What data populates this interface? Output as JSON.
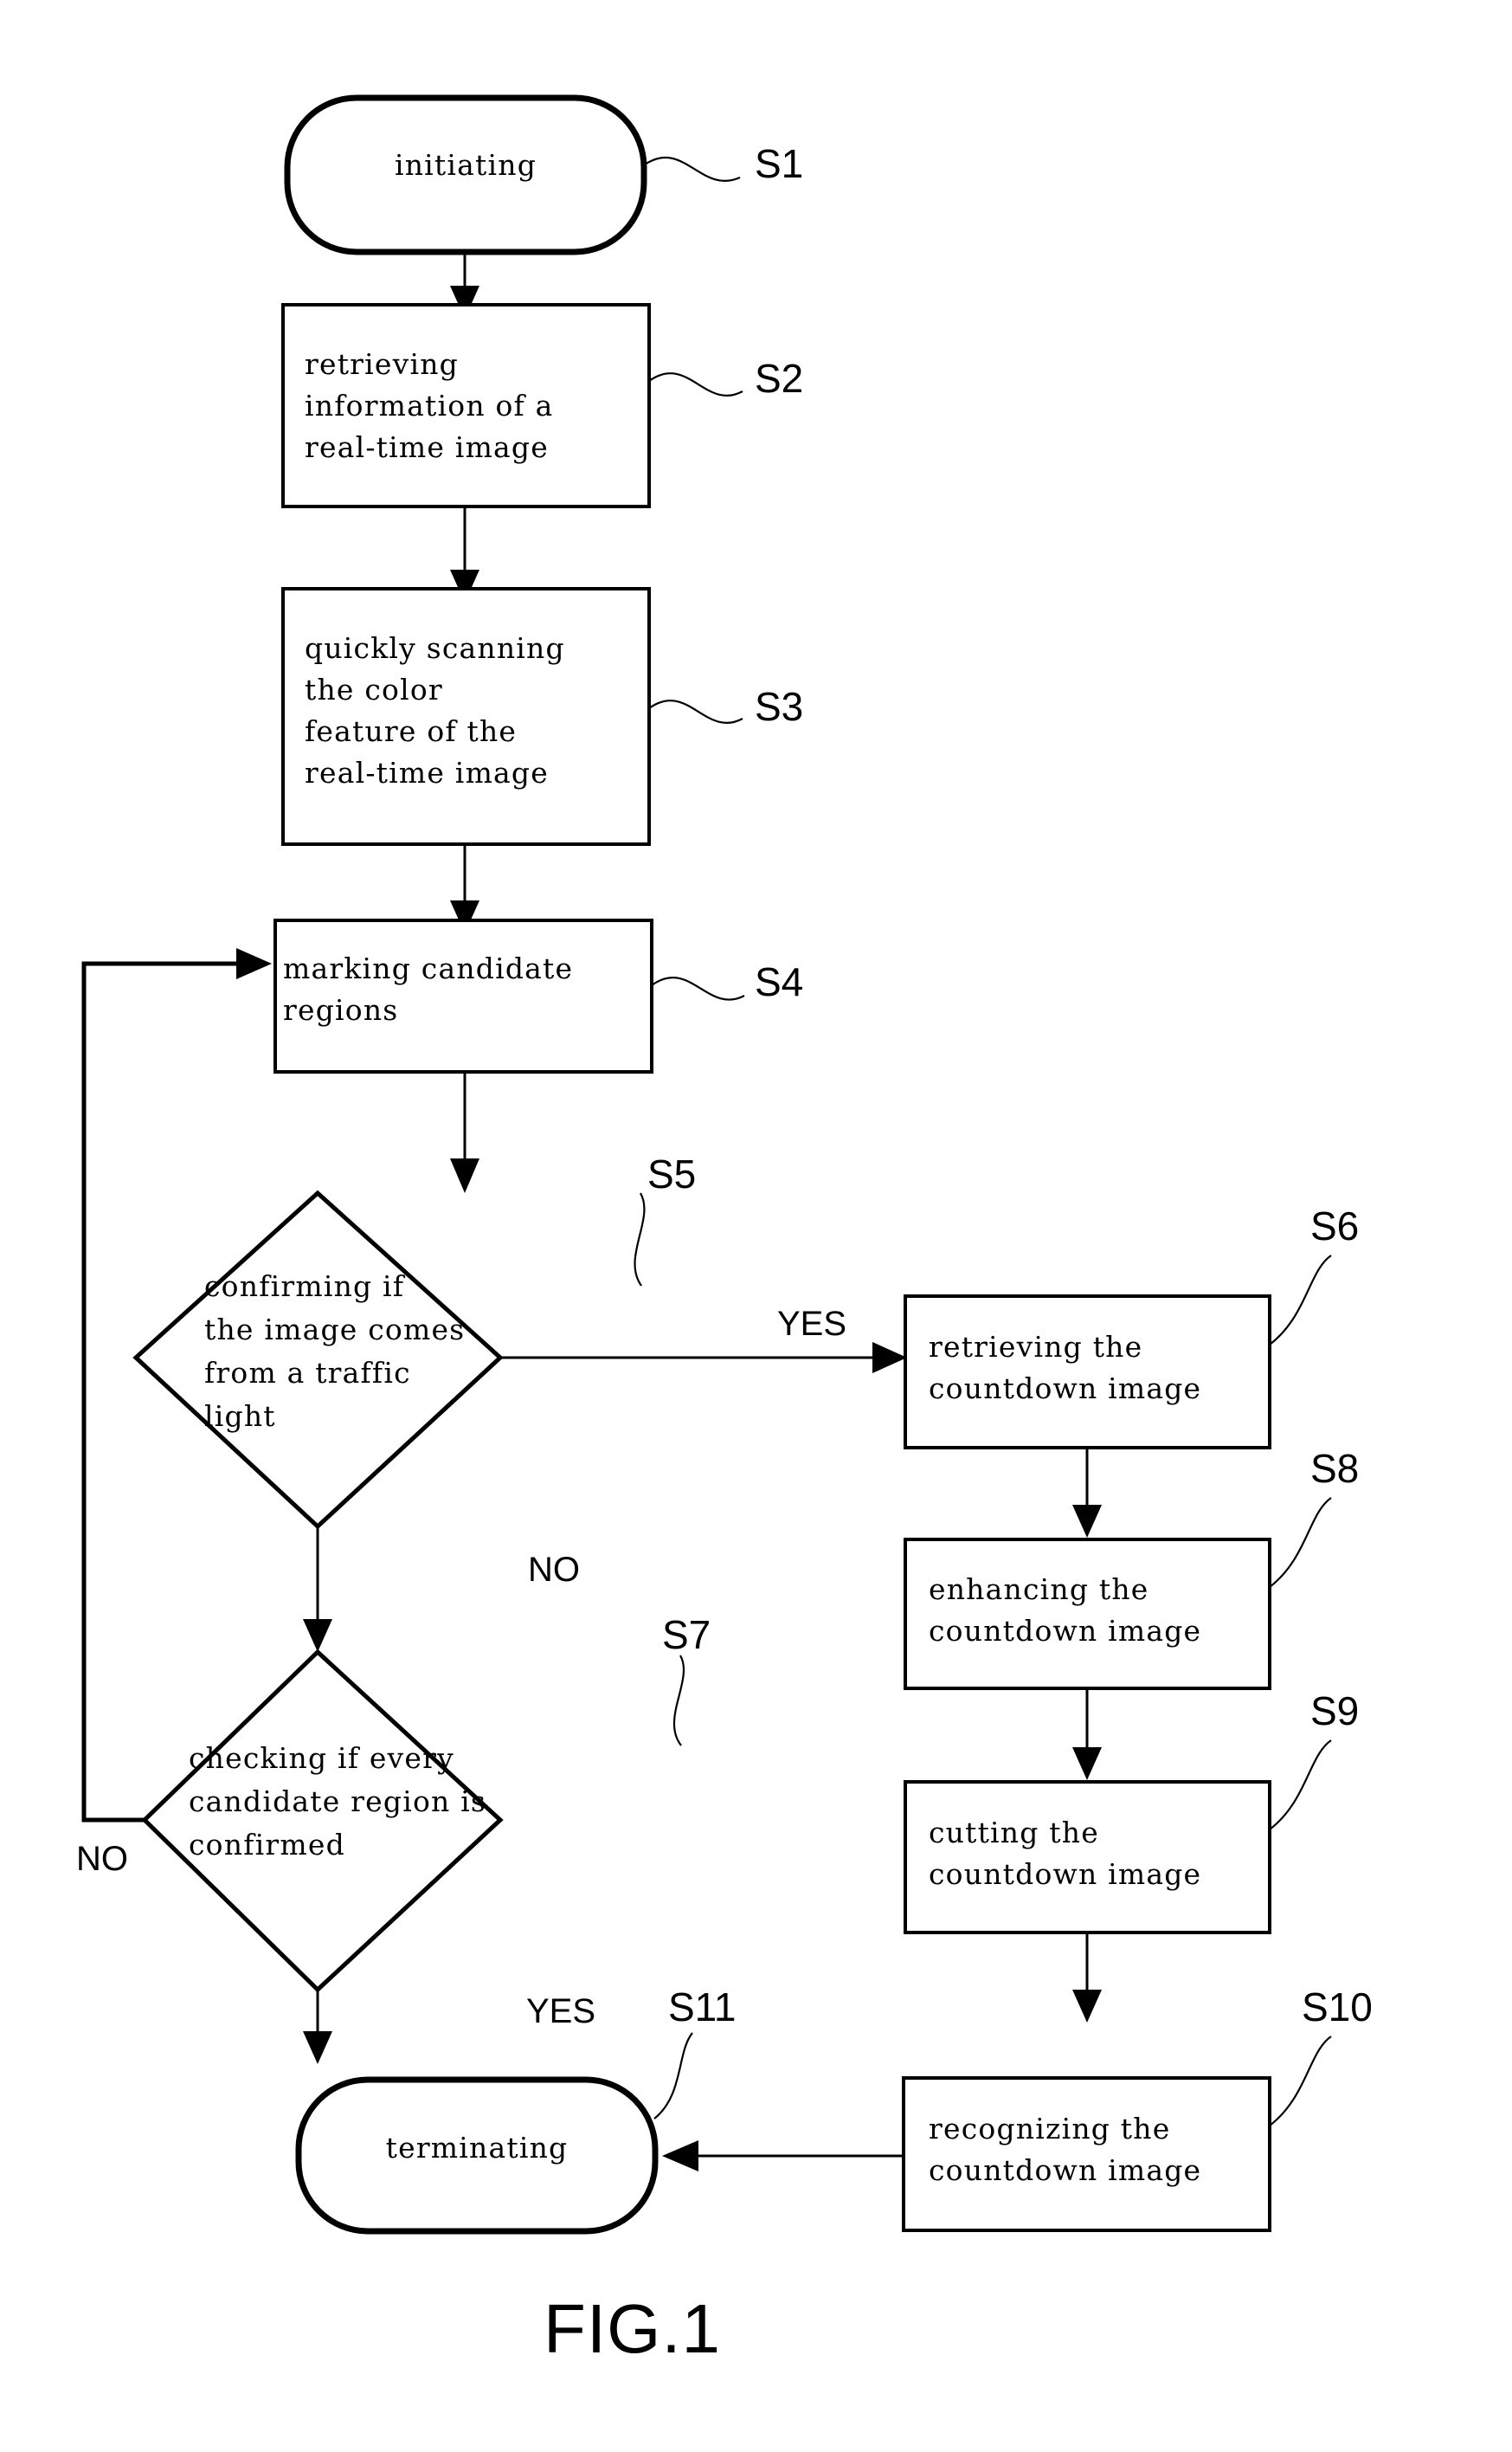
{
  "figure": {
    "caption": "FIG.1",
    "nodes": {
      "s1": {
        "ref": "S1",
        "type": "terminator",
        "lines": [
          "initiating"
        ]
      },
      "s2": {
        "ref": "S2",
        "type": "process",
        "lines": [
          "retrieving",
          "information of a",
          "real-time image"
        ]
      },
      "s3": {
        "ref": "S3",
        "type": "process",
        "lines": [
          "quickly scanning",
          "the color",
          "feature of the",
          "real-time image"
        ]
      },
      "s4": {
        "ref": "S4",
        "type": "process",
        "lines": [
          "marking candidate",
          "regions"
        ]
      },
      "s5": {
        "ref": "S5",
        "type": "decision",
        "lines": [
          "confirming if",
          "the image comes",
          "from a traffic",
          "light"
        ]
      },
      "s6": {
        "ref": "S6",
        "type": "process",
        "lines": [
          "retrieving the",
          "countdown image"
        ]
      },
      "s7": {
        "ref": "S7",
        "type": "decision",
        "lines": [
          "checking if every",
          "candidate region is",
          "confirmed"
        ]
      },
      "s8": {
        "ref": "S8",
        "type": "process",
        "lines": [
          "enhancing the",
          "countdown image"
        ]
      },
      "s9": {
        "ref": "S9",
        "type": "process",
        "lines": [
          "cutting the",
          "countdown image"
        ]
      },
      "s10": {
        "ref": "S10",
        "type": "process",
        "lines": [
          "recognizing the",
          "countdown image"
        ]
      },
      "s11": {
        "ref": "S11",
        "type": "terminator",
        "lines": [
          "terminating"
        ]
      }
    },
    "branch_labels": {
      "s5_yes": "YES",
      "s5_no": "NO",
      "s7_yes": "YES",
      "s7_no": "NO"
    },
    "colors": {
      "stroke": "#000000",
      "fill": "#ffffff"
    }
  }
}
